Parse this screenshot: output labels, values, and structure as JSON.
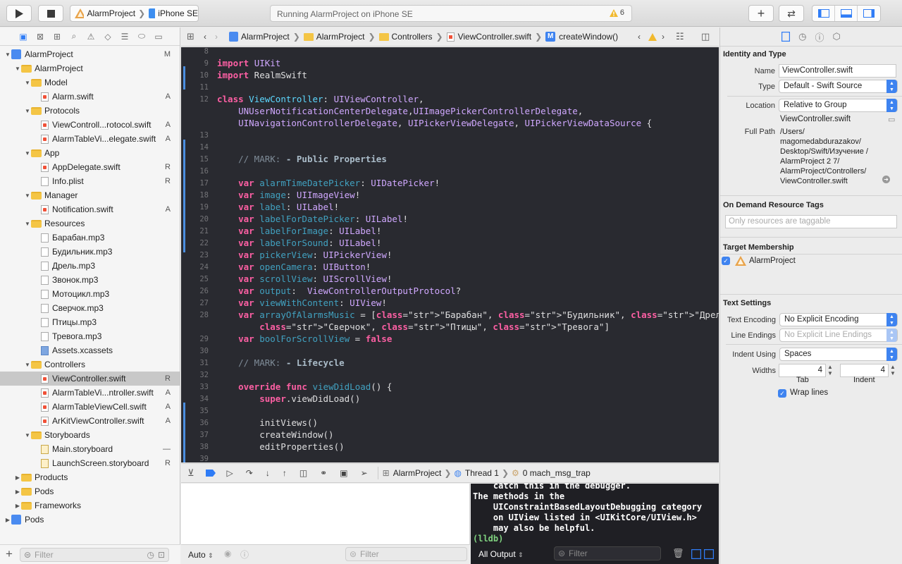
{
  "toolbar": {
    "scheme_project": "AlarmProject",
    "scheme_device": "iPhone SE",
    "activity_text": "Running AlarmProject on iPhone SE",
    "warning_count": "6"
  },
  "navigator": {
    "filter_placeholder": "Filter",
    "items": [
      {
        "label": "AlarmProject",
        "status": "M"
      },
      {
        "label": "AlarmProject",
        "status": ""
      },
      {
        "label": "Model",
        "status": ""
      },
      {
        "label": "Alarm.swift",
        "status": "A"
      },
      {
        "label": "Protocols",
        "status": ""
      },
      {
        "label": "ViewControll...rotocol.swift",
        "status": "A"
      },
      {
        "label": "AlarmTableVi...elegate.swift",
        "status": "A"
      },
      {
        "label": "App",
        "status": ""
      },
      {
        "label": "AppDelegate.swift",
        "status": "R"
      },
      {
        "label": "Info.plist",
        "status": "R"
      },
      {
        "label": "Manager",
        "status": ""
      },
      {
        "label": "Notification.swift",
        "status": "A"
      },
      {
        "label": "Resources",
        "status": ""
      },
      {
        "label": "Барабан.mp3",
        "status": ""
      },
      {
        "label": "Будильник.mp3",
        "status": ""
      },
      {
        "label": "Дрель.mp3",
        "status": ""
      },
      {
        "label": "Звонок.mp3",
        "status": ""
      },
      {
        "label": "Мотоцикл.mp3",
        "status": ""
      },
      {
        "label": "Сверчок.mp3",
        "status": ""
      },
      {
        "label": "Птицы.mp3",
        "status": ""
      },
      {
        "label": "Тревога.mp3",
        "status": ""
      },
      {
        "label": "Assets.xcassets",
        "status": ""
      },
      {
        "label": "Controllers",
        "status": ""
      },
      {
        "label": "ViewController.swift",
        "status": "R"
      },
      {
        "label": "AlarmTableVi...ntroller.swift",
        "status": "A"
      },
      {
        "label": "AlarmTableViewCell.swift",
        "status": "A"
      },
      {
        "label": "ArKitViewController.swift",
        "status": "A"
      },
      {
        "label": "Storyboards",
        "status": ""
      },
      {
        "label": "Main.storyboard",
        "status": "—"
      },
      {
        "label": "LaunchScreen.storyboard",
        "status": "R"
      },
      {
        "label": "Products",
        "status": ""
      },
      {
        "label": "Pods",
        "status": ""
      },
      {
        "label": "Frameworks",
        "status": ""
      },
      {
        "label": "Pods",
        "status": ""
      }
    ]
  },
  "jumpbar": {
    "crumbs": [
      "AlarmProject",
      "AlarmProject",
      "Controllers",
      "ViewController.swift",
      "createWindow()"
    ]
  },
  "editor": {
    "lines": [
      {
        "n": "8",
        "t": ""
      },
      {
        "n": "9",
        "t": "import UIKit"
      },
      {
        "n": "10",
        "t": "import RealmSwift"
      },
      {
        "n": "11",
        "t": ""
      },
      {
        "n": "12",
        "t": "class ViewController: UIViewController,"
      },
      {
        "n": "",
        "t": "    UNUserNotificationCenterDelegate,UIImagePickerControllerDelegate,"
      },
      {
        "n": "",
        "t": "    UINavigationControllerDelegate, UIPickerViewDelegate, UIPickerViewDataSource {"
      },
      {
        "n": "13",
        "t": ""
      },
      {
        "n": "14",
        "t": ""
      },
      {
        "n": "15",
        "t": "    // MARK: - Public Properties"
      },
      {
        "n": "16",
        "t": ""
      },
      {
        "n": "17",
        "t": "    var alarmTimeDatePicker: UIDatePicker!"
      },
      {
        "n": "18",
        "t": "    var image: UIImageView!"
      },
      {
        "n": "19",
        "t": "    var label: UILabel!"
      },
      {
        "n": "20",
        "t": "    var labelForDatePicker: UILabel!"
      },
      {
        "n": "21",
        "t": "    var labelForImage: UILabel!"
      },
      {
        "n": "22",
        "t": "    var labelForSound: UILabel!"
      },
      {
        "n": "23",
        "t": "    var pickerView: UIPickerView!"
      },
      {
        "n": "24",
        "t": "    var openCamera: UIButton!"
      },
      {
        "n": "25",
        "t": "    var scrollView: UIScrollView!"
      },
      {
        "n": "26",
        "t": "    var output:  ViewControllerOutputProtocol?"
      },
      {
        "n": "27",
        "t": "    var viewWithContent: UIView!"
      },
      {
        "n": "28",
        "t": "    var arrayOfAlarmsMusic = [\"Барабан\", \"Будильник\", \"Дрель\", \"Звонок\", \"Мотоцикл\","
      },
      {
        "n": "",
        "t": "        \"Сверчок\", \"Птицы\", \"Тревога\"]"
      },
      {
        "n": "29",
        "t": "    var boolForScrollView = false"
      },
      {
        "n": "30",
        "t": ""
      },
      {
        "n": "31",
        "t": "    // MARK: - Lifecycle"
      },
      {
        "n": "32",
        "t": ""
      },
      {
        "n": "33",
        "t": "    override func viewDidLoad() {"
      },
      {
        "n": "34",
        "t": "        super.viewDidLoad()"
      },
      {
        "n": "35",
        "t": ""
      },
      {
        "n": "36",
        "t": "        initViews()"
      },
      {
        "n": "37",
        "t": "        createWindow()"
      },
      {
        "n": "38",
        "t": "        editProperties()"
      },
      {
        "n": "39",
        "t": ""
      }
    ]
  },
  "debug": {
    "crumb_project": "AlarmProject",
    "crumb_thread": "Thread 1",
    "crumb_frame": "0 mach_msg_trap",
    "console_lines": [
      "    catch this in the debugger.",
      "The methods in the",
      "    UIConstraintBasedLayoutDebugging category",
      "    on UIView listed in <UIKitCore/UIView.h>",
      "    may also be helpful.",
      "(lldb)"
    ],
    "auto_label": "Auto",
    "var_filter_placeholder": "Filter",
    "output_label": "All Output",
    "console_filter_placeholder": "Filter"
  },
  "inspector": {
    "identity_title": "Identity and Type",
    "name_label": "Name",
    "name_value": "ViewController.swift",
    "type_label": "Type",
    "type_value": "Default - Swift Source",
    "location_label": "Location",
    "location_value": "Relative to Group",
    "location_file": "ViewController.swift",
    "fullpath_label": "Full Path",
    "fullpath_lines": [
      "/Users/",
      "magomedabdurazakov/",
      "Desktop/Swift/Изучение /",
      "AlarmProject 2 7/",
      "AlarmProject/Controllers/",
      "ViewController.swift"
    ],
    "odr_title": "On Demand Resource Tags",
    "odr_placeholder": "Only resources are taggable",
    "target_title": "Target Membership",
    "target_item": "AlarmProject",
    "text_title": "Text Settings",
    "encoding_label": "Text Encoding",
    "encoding_value": "No Explicit Encoding",
    "line_endings_label": "Line Endings",
    "line_endings_value": "No Explicit Line Endings",
    "indent_using_label": "Indent Using",
    "indent_using_value": "Spaces",
    "widths_label": "Widths",
    "tab_value": "4",
    "tab_caption": "Tab",
    "indent_value": "4",
    "indent_caption": "Indent",
    "wrap_label": "Wrap lines"
  }
}
